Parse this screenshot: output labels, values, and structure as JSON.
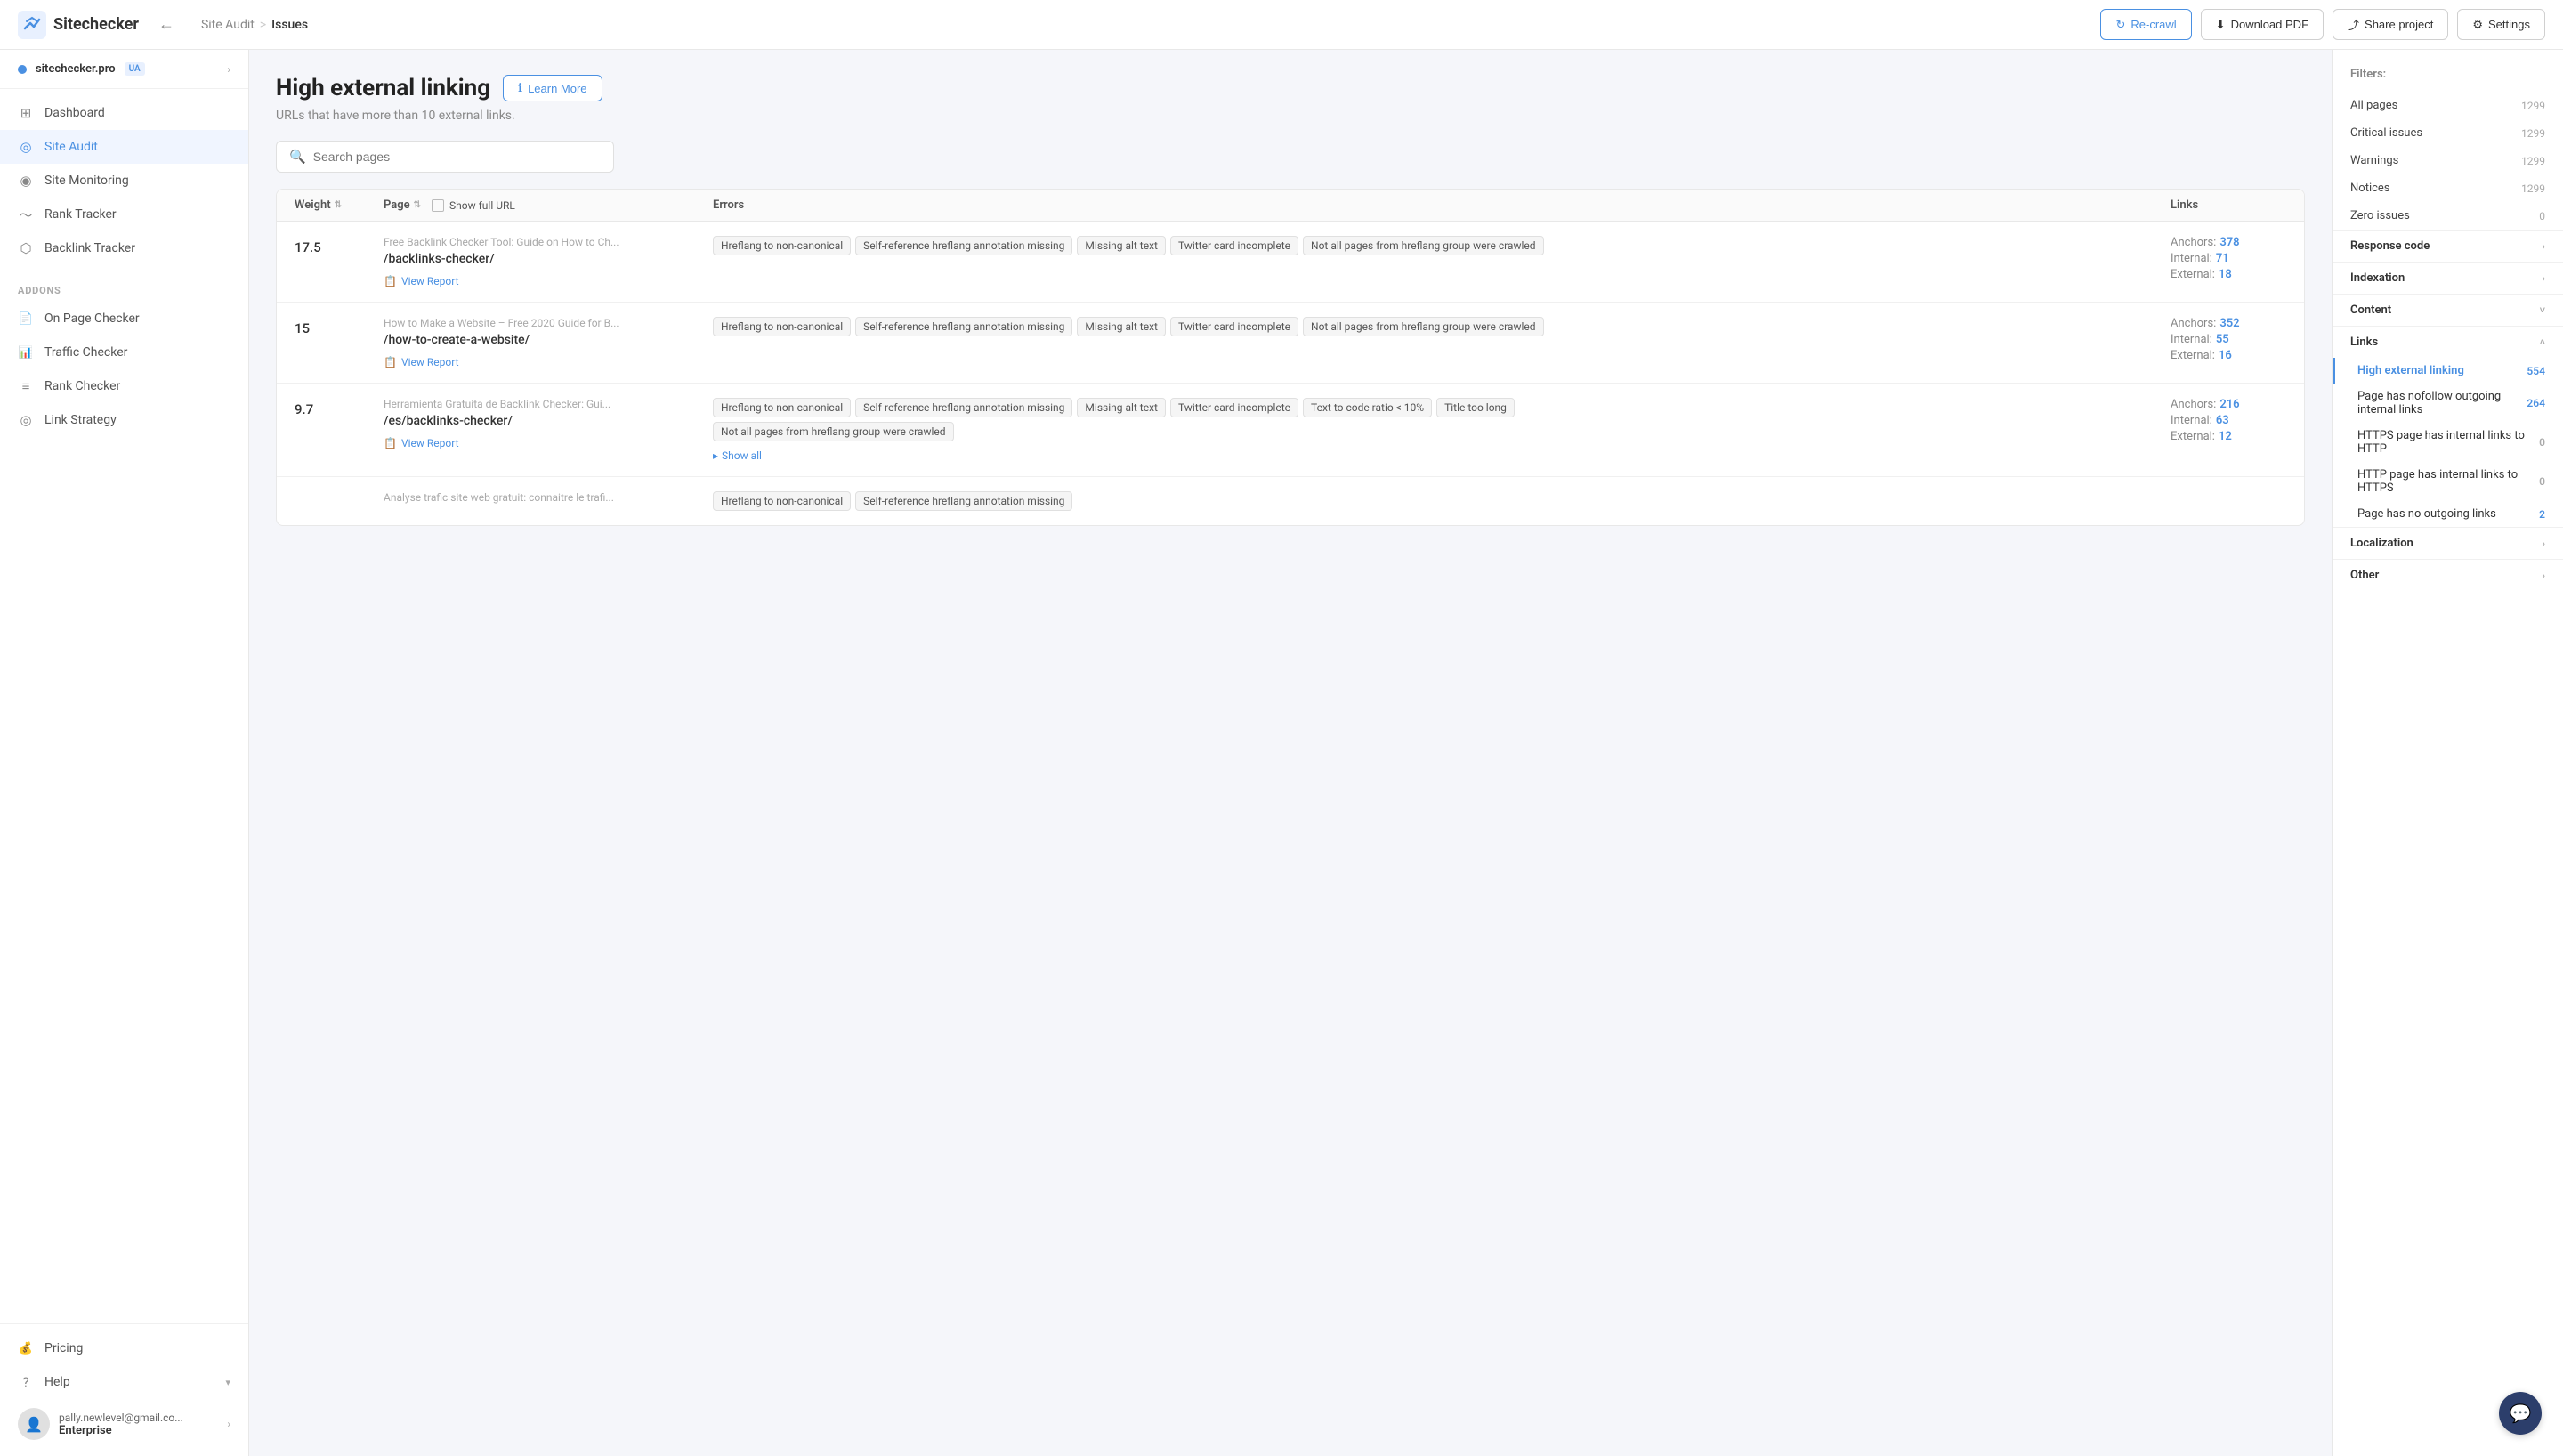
{
  "topnav": {
    "logo_text": "Sitechecker",
    "back_icon": "←",
    "breadcrumb_parent": "Site Audit",
    "breadcrumb_sep": ">",
    "breadcrumb_current": "Issues",
    "btn_recrawl": "Re-crawl",
    "btn_download": "Download PDF",
    "btn_share": "Share project",
    "btn_settings": "Settings"
  },
  "sidebar": {
    "account_name": "sitechecker.pro",
    "account_badge": "UA",
    "nav_items": [
      {
        "label": "Dashboard",
        "icon": "⊞"
      },
      {
        "label": "Site Audit",
        "icon": "◎",
        "active": true
      },
      {
        "label": "Site Monitoring",
        "icon": "◉"
      },
      {
        "label": "Rank Tracker",
        "icon": "〜"
      },
      {
        "label": "Backlink Tracker",
        "icon": "⬡"
      }
    ],
    "addons_label": "Addons",
    "addon_items": [
      {
        "label": "On Page Checker",
        "icon": "📄"
      },
      {
        "label": "Traffic Checker",
        "icon": "📊"
      },
      {
        "label": "Rank Checker",
        "icon": "≡"
      },
      {
        "label": "Link Strategy",
        "icon": "◎"
      }
    ],
    "pricing_label": "Pricing",
    "help_label": "Help",
    "user_email": "pally.newlevel@gmail.co...",
    "user_plan": "Enterprise"
  },
  "page": {
    "title": "High external linking",
    "subtitle": "URLs that have more than 10 external links.",
    "learn_more": "Learn More",
    "search_placeholder": "Search pages",
    "show_full_url": "Show full URL"
  },
  "table": {
    "columns": [
      "Weight",
      "Page",
      "Errors",
      "Links"
    ],
    "rows": [
      {
        "weight": "17.5",
        "page_title": "Free Backlink Checker Tool: Guide on How to Ch...",
        "page_url": "/backlinks-checker/",
        "errors": [
          "Hreflang to non-canonical",
          "Self-reference hreflang annotation missing",
          "Missing alt text",
          "Twitter card incomplete",
          "Not all pages from hreflang group were crawled"
        ],
        "anchors": "378",
        "internal": "71",
        "external": "18"
      },
      {
        "weight": "15",
        "page_title": "How to Make a Website – Free 2020 Guide for B...",
        "page_url": "/how-to-create-a-website/",
        "errors": [
          "Hreflang to non-canonical",
          "Self-reference hreflang annotation missing",
          "Missing alt text",
          "Twitter card incomplete",
          "Not all pages from hreflang group were crawled"
        ],
        "anchors": "352",
        "internal": "55",
        "external": "16"
      },
      {
        "weight": "9.7",
        "page_title": "Herramienta Gratuita de Backlink Checker: Gui...",
        "page_url": "/es/backlinks-checker/",
        "errors": [
          "Hreflang to non-canonical",
          "Self-reference hreflang annotation missing",
          "Missing alt text",
          "Twitter card incomplete",
          "Text to code ratio < 10%",
          "Title too long",
          "Not all pages from hreflang group were crawled"
        ],
        "show_all": "Show all",
        "anchors": "216",
        "internal": "63",
        "external": "12"
      },
      {
        "weight": "",
        "page_title": "Analyse trafic site web gratuit: connaitre le trafi...",
        "page_url": "",
        "errors": [
          "Hreflang to non-canonical",
          "Self-reference hreflang annotation missing"
        ],
        "anchors": "",
        "internal": "",
        "external": ""
      }
    ],
    "view_report_label": "View Report"
  },
  "filters": {
    "title": "Filters:",
    "top_items": [
      {
        "label": "All pages",
        "count": "1299"
      },
      {
        "label": "Critical issues",
        "count": "1299"
      },
      {
        "label": "Warnings",
        "count": "1299"
      },
      {
        "label": "Notices",
        "count": "1299"
      },
      {
        "label": "Zero issues",
        "count": "0"
      }
    ],
    "sections": [
      {
        "label": "Response code",
        "expanded": false
      },
      {
        "label": "Indexation",
        "expanded": false
      },
      {
        "label": "Content",
        "expanded": false
      },
      {
        "label": "Links",
        "expanded": true,
        "sub_items": [
          {
            "label": "High external linking",
            "count": "554",
            "active": true
          },
          {
            "label": "Page has nofollow outgoing internal links",
            "count": "264"
          },
          {
            "label": "HTTPS page has internal links to HTTP",
            "count": "0"
          },
          {
            "label": "HTTP page has internal links to HTTPS",
            "count": "0"
          },
          {
            "label": "Page has no outgoing links",
            "count": "2"
          }
        ]
      },
      {
        "label": "Localization",
        "expanded": false
      },
      {
        "label": "Other",
        "expanded": false
      }
    ]
  },
  "chat": {
    "icon": "💬"
  }
}
